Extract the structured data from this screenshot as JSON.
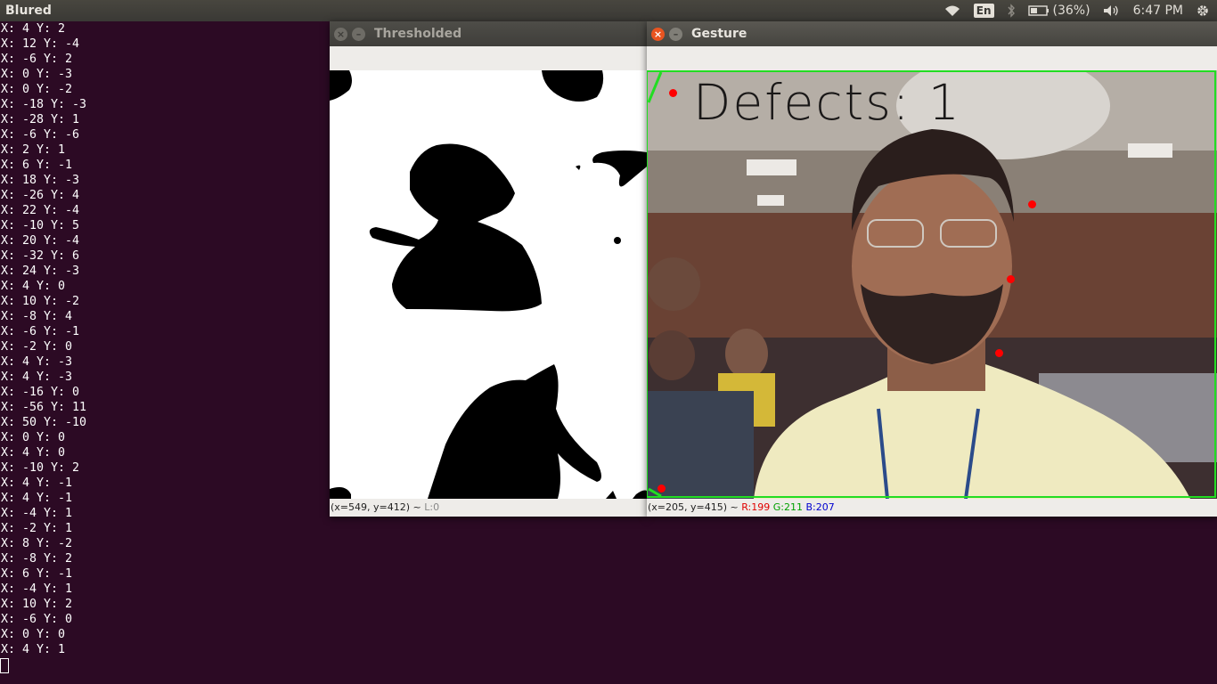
{
  "panel": {
    "app_title": "Blured",
    "keyboard_layout": "En",
    "battery_text": "(36%)",
    "clock": "6:47 PM"
  },
  "terminal": {
    "lines": [
      "X: 4 Y: 2",
      "X: 12 Y: -4",
      "X: -6 Y: 2",
      "X: 0 Y: -3",
      "X: 0 Y: -2",
      "X: -18 Y: -3",
      "X: -28 Y: 1",
      "X: -6 Y: -6",
      "X: 2 Y: 1",
      "X: 6 Y: -1",
      "X: 18 Y: -3",
      "X: -26 Y: 4",
      "X: 22 Y: -4",
      "X: -10 Y: 5",
      "X: 20 Y: -4",
      "X: -32 Y: 6",
      "X: 24 Y: -3",
      "X: 4 Y: 0",
      "X: 10 Y: -2",
      "X: -8 Y: 4",
      "X: -6 Y: -1",
      "X: -2 Y: 0",
      "X: 4 Y: -3",
      "X: 4 Y: -3",
      "X: -16 Y: 0",
      "X: -56 Y: 11",
      "X: 50 Y: -10",
      "X: 0 Y: 0",
      "X: 4 Y: 0",
      "X: -10 Y: 2",
      "X: 4 Y: -1",
      "X: 4 Y: -1",
      "X: -4 Y: 1",
      "X: -2 Y: 1",
      "X: 8 Y: -2",
      "X: -8 Y: 2",
      "X: 6 Y: -1",
      "X: -4 Y: 1",
      "X: 10 Y: 2",
      "X: -6 Y: 0",
      "X: 0 Y: 0",
      "X: 4 Y: 1"
    ]
  },
  "thresholded": {
    "title": "Thresholded",
    "status_coords": "(x=549, y=412) ~",
    "status_value": "L:0"
  },
  "gesture": {
    "title": "Gesture",
    "overlay_text": "Defects:  1",
    "status_coords": "(x=205, y=415) ~",
    "status_r": "R:199",
    "status_g": "G:211",
    "status_b": "B:207"
  },
  "colors": {
    "terminal_bg": "#2c0a24",
    "hull_green": "#22dd22",
    "defect_red": "#ff0000",
    "close_orange": "#e95420"
  }
}
